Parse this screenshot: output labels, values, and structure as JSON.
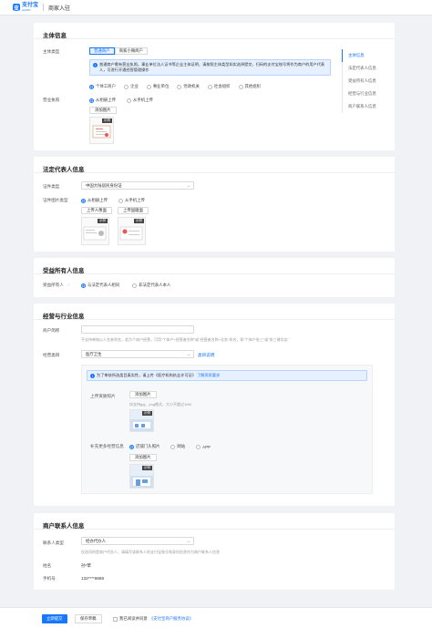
{
  "header": {
    "logo_mark": "支",
    "logo_text": "支付宝",
    "logo_sub": "ALIPAY",
    "title": "商家入驻"
  },
  "nav": [
    "主体信息",
    "法定代表人信息",
    "受益所有人信息",
    "经营与行业信息",
    "商户联系人信息"
  ],
  "subject": {
    "title": "主体信息",
    "type_label": "主体类型",
    "tabs": [
      "普通商户",
      "商家小微商户"
    ],
    "notice": "普通商户需有营业执照。事业单位法人证书等企业主体证明，请按照主体类型如实选择提交，扫码的支付宝账号将作为商户的用户代表人，可进行开通经营管理操作",
    "entity_types": [
      "个体工商户",
      "企业",
      "事业单位",
      "党政机关",
      "社会组织",
      "其他组织"
    ],
    "license_label": "营业执照",
    "license_sources": [
      "从相册上传",
      "从手机上传"
    ],
    "upload_btn": "添加图片",
    "sample": "示例"
  },
  "legal": {
    "title": "法定代表人信息",
    "doc_type_label": "证件类型",
    "doc_type_value": "中国大陆居民身份证",
    "photo_label": "证件图片类型",
    "photo_sources": [
      "从相册上传",
      "从手机上传"
    ],
    "front_btn": "上传人像面",
    "back_btn": "上传国徽面",
    "sample": "示例"
  },
  "beneficiary": {
    "title": "受益所有人信息",
    "label": "受益所有人",
    "options": [
      "与法定代表人相同",
      "非法定代表人本人"
    ]
  },
  "business": {
    "title": "经营与行业信息",
    "name_label": "商户简称",
    "name_hint": "不支持单纯以人名来命名，若为个体户经营，可用\"个体户+经营者名称\"或\"经营者名称+业务\"命名，如\"个体户张三\"或\"张三餐饮店\"",
    "category_label": "经营类目",
    "category_value": "医疗卫生",
    "category_link": "类目说明",
    "notice": "为了审核所选类目真实性，请上传《医疗机构执业许可证》",
    "notice_link": "了解资质要求",
    "qual_label": "上传资质照片",
    "qual_btn": "添加图片",
    "qual_hint": "仅支持jpg、png格式，大小不超过10M",
    "sample": "示例",
    "site_label": "补充更多经营信息",
    "site_options": [
      "店铺门头照片",
      "网站",
      "APP"
    ],
    "site_btn": "添加图片"
  },
  "contact": {
    "title": "商户联系人信息",
    "type_label": "联系人类型",
    "type_value": "经办代办人",
    "type_hint": "仅选项的是商户代办人，请填写该联系人的支付宝账号和身份信息作为商户联系人信息",
    "name_label": "姓名",
    "name_value": "孙*苹",
    "phone_label": "手机号",
    "phone_value": "132****8686"
  },
  "footer": {
    "submit": "立即提交",
    "save": "保存草稿",
    "agree_prefix": "我已阅读并同意",
    "agree_link": "《支付宝商户服务协议》"
  }
}
